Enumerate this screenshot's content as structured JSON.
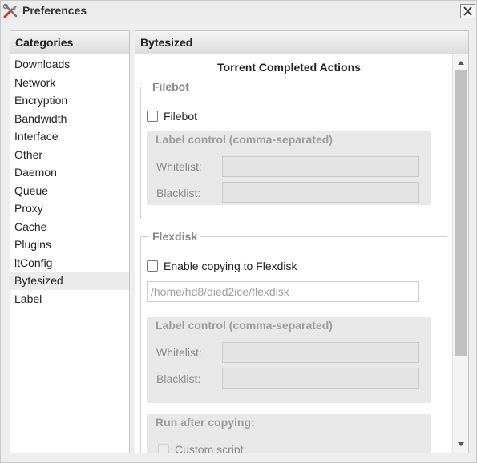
{
  "window": {
    "title": "Preferences"
  },
  "icons": {
    "app": "tools-icon",
    "close": "close-icon"
  },
  "categories": {
    "header": "Categories",
    "items": [
      "Downloads",
      "Network",
      "Encryption",
      "Bandwidth",
      "Interface",
      "Other",
      "Daemon",
      "Queue",
      "Proxy",
      "Cache",
      "Plugins",
      "ltConfig",
      "Bytesized",
      "Label"
    ],
    "selected": "Bytesized"
  },
  "main": {
    "header": "Bytesized",
    "section_title": "Torrent Completed Actions",
    "filebot": {
      "legend": "Filebot",
      "checkbox_label": "Filebot",
      "label_control": {
        "title": "Label control (comma-separated)",
        "whitelist_label": "Whitelist:",
        "blacklist_label": "Blacklist:"
      }
    },
    "flexdisk": {
      "legend": "Flexdisk",
      "checkbox_label": "Enable copying to Flexdisk",
      "path_placeholder": "/home/hd8/died2ice/flexdisk",
      "label_control": {
        "title": "Label control (comma-separated)",
        "whitelist_label": "Whitelist:",
        "blacklist_label": "Blacklist:"
      },
      "run_after": {
        "title": "Run after copying:",
        "custom_script_label": "Custom script:"
      }
    }
  }
}
